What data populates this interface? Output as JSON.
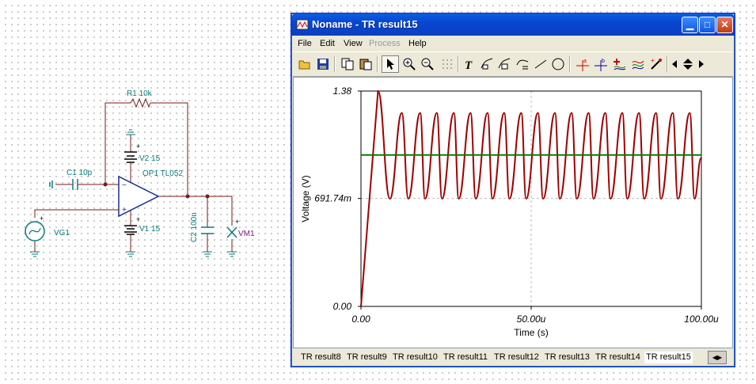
{
  "schematic": {
    "r1": "R1 10k",
    "c1": "C1 10p",
    "v2": "V2 15",
    "op1": "OP1 TL052",
    "v1": "V1 15",
    "vg1": "VG1",
    "c2": "C2 100n",
    "vm1": "VM1"
  },
  "window": {
    "title": "Noname - TR result15",
    "menu": [
      "File",
      "Edit",
      "View",
      "Process",
      "Help"
    ],
    "disabled_menu": [
      "Process"
    ]
  },
  "toolbar": {
    "icons": [
      "open-folder-icon",
      "save-disk-icon",
      "copy-icon",
      "paste-icon",
      "pointer-icon",
      "zoom-in-icon",
      "zoom-out-100-icon",
      "grid-icon",
      "text-tool-icon",
      "curve-label-icon",
      "curve-label-2-icon",
      "curve-formula-icon",
      "line-tool-icon",
      "circle-tool-icon",
      "cursor-a-icon",
      "cursor-b-icon",
      "add-curve-icon",
      "curves-icon",
      "probe-icon",
      "scroll-left-icon",
      "scroll-updown-icon",
      "scroll-right-icon"
    ]
  },
  "chart_data": {
    "type": "line",
    "xlabel": "Time (s)",
    "ylabel": "Voltage (V)",
    "xlim": [
      0,
      100
    ],
    "ylim": [
      0,
      1.38
    ],
    "x_unit": "u",
    "x_ticks": [
      "0.00",
      "50.00u",
      "100.00u"
    ],
    "y_ticks": [
      "0.00",
      "691.74m",
      "1.38"
    ],
    "grid": "dashed",
    "series": [
      {
        "color": "#a00000",
        "description_points": {
          "x": [
            0,
            5,
            8.5,
            12,
            13.9,
            17.4,
            18.8,
            22.3,
            23.8,
            27.3,
            28.7,
            32.2,
            33.7,
            37.2,
            38.6,
            42.1,
            43.6,
            47.1,
            48.5,
            52.0,
            53.5,
            57.0,
            58.4,
            61.9,
            63.4,
            66.9,
            68.3,
            71.8,
            73.3,
            76.8,
            78.2,
            81.7,
            83.2,
            86.7,
            88.1,
            91.6,
            93.1,
            96.6,
            98.0,
            99.9
          ],
          "y": [
            0,
            1.38,
            0.69,
            1.24,
            0.69,
            1.24,
            0.69,
            1.24,
            0.69,
            1.24,
            0.69,
            1.24,
            0.69,
            1.24,
            0.69,
            1.24,
            0.69,
            1.24,
            0.69,
            1.24,
            0.69,
            1.24,
            0.69,
            1.24,
            0.69,
            1.24,
            0.69,
            1.24,
            0.69,
            1.24,
            0.69,
            1.24,
            0.69,
            1.24,
            0.69,
            1.24,
            0.69,
            1.24,
            0.69,
            0.95
          ]
        }
      },
      {
        "color": "#008000",
        "description_points": {
          "x": [
            0,
            100
          ],
          "y": [
            0.97,
            0.97
          ]
        }
      }
    ]
  },
  "tabs": [
    "TR result8",
    "TR result9",
    "TR result10",
    "TR result11",
    "TR result12",
    "TR result13",
    "TR result14",
    "TR result15"
  ],
  "active_tab": "TR result15"
}
